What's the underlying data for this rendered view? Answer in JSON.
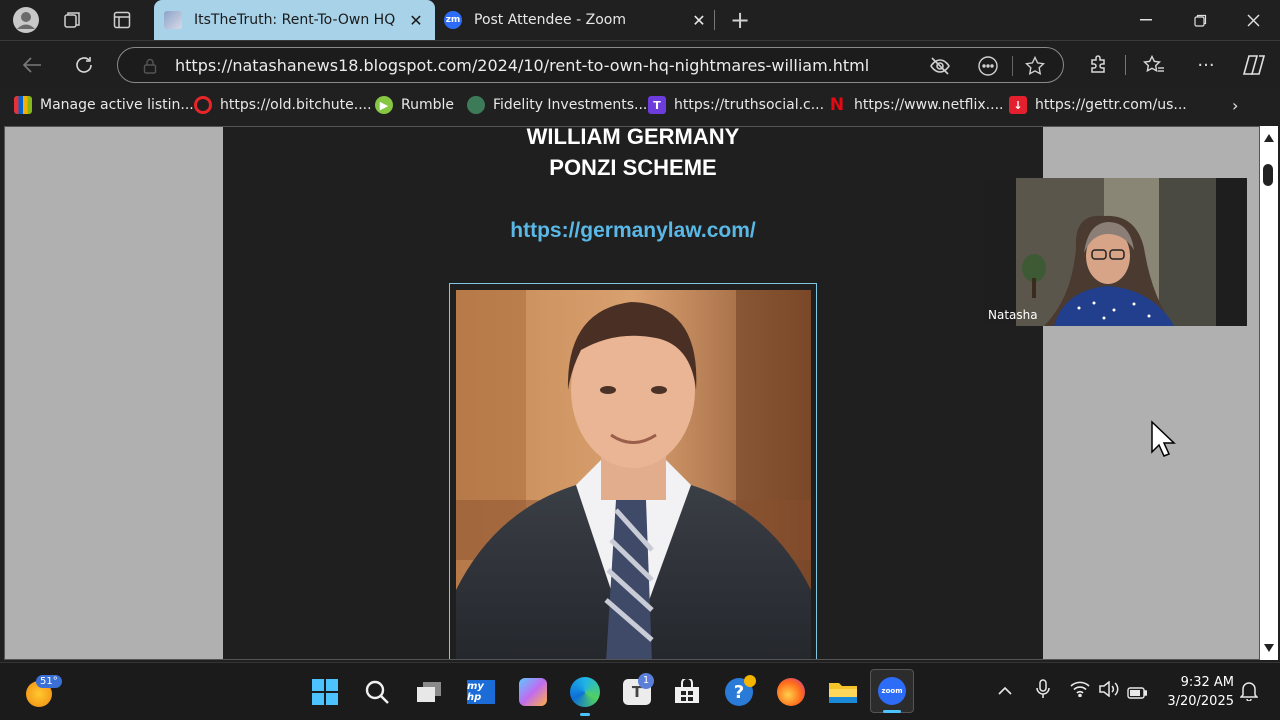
{
  "browser": {
    "tabs": [
      {
        "title": "ItsTheTruth: Rent-To-Own HQ Nig",
        "active": true
      },
      {
        "title": "Post Attendee - Zoom",
        "active": false
      }
    ],
    "favicon_zoom_text": "zm",
    "url": "https://natashanews18.blogspot.com/2024/10/rent-to-own-hq-nightmares-william.html",
    "bookmarks": [
      {
        "label": "Manage active listin..."
      },
      {
        "label": "https://old.bitchute...."
      },
      {
        "label": "Rumble"
      },
      {
        "label": "Fidelity Investments..."
      },
      {
        "label": "https://truthsocial.c..."
      },
      {
        "label": "https://www.netflix...."
      },
      {
        "label": "https://gettr.com/us..."
      }
    ]
  },
  "blog": {
    "headline_1": "WILLIAM GERMANY",
    "headline_2": "PONZI SCHEME",
    "link": "https://germanylaw.com/"
  },
  "zoom_overlay": {
    "participant_name": "Natasha"
  },
  "taskbar": {
    "weather_temp": "51°",
    "teams_badge": "1",
    "time": "9:32 AM",
    "date": "3/20/2025"
  },
  "colors": {
    "active_tab": "#a7d2e8",
    "link": "#5ab8e6",
    "blog_bg": "#1f1f1f",
    "page_bg": "#b0b0b0"
  }
}
